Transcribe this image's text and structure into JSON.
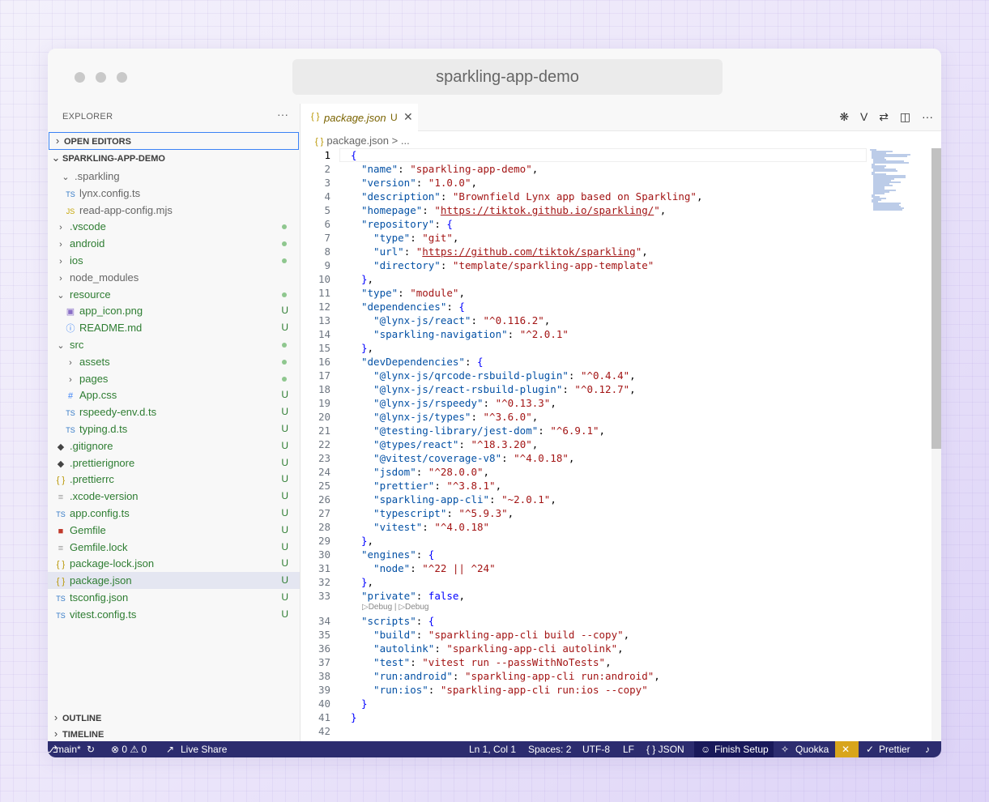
{
  "window": {
    "title": "sparkling-app-demo"
  },
  "explorer": {
    "header": "EXPLORER",
    "more": "···",
    "open_editors": "OPEN EDITORS",
    "project": "SPARKLING-APP-DEMO",
    "outline": "OUTLINE",
    "timeline": "TIMELINE",
    "items": [
      {
        "label": ".sparkling",
        "icon": "chevron-down",
        "status": ""
      },
      {
        "label": "lynx.config.ts",
        "icon": "TS",
        "status": ""
      },
      {
        "label": "read-app-config.mjs",
        "icon": "JS",
        "status": ""
      },
      {
        "label": ".vscode",
        "icon": "chevron-right",
        "status": "dot"
      },
      {
        "label": "android",
        "icon": "chevron-right",
        "status": "dot"
      },
      {
        "label": "ios",
        "icon": "chevron-right",
        "status": "dot"
      },
      {
        "label": "node_modules",
        "icon": "chevron-right",
        "status": ""
      },
      {
        "label": "resource",
        "icon": "chevron-down",
        "status": "dot"
      },
      {
        "label": "app_icon.png",
        "icon": "image",
        "status": "U"
      },
      {
        "label": "README.md",
        "icon": "info",
        "status": "U"
      },
      {
        "label": "src",
        "icon": "chevron-down",
        "status": "dot"
      },
      {
        "label": "assets",
        "icon": "chevron-right",
        "status": "dot"
      },
      {
        "label": "pages",
        "icon": "chevron-right",
        "status": "dot"
      },
      {
        "label": "App.css",
        "icon": "#",
        "status": "U"
      },
      {
        "label": "rspeedy-env.d.ts",
        "icon": "TS",
        "status": "U"
      },
      {
        "label": "typing.d.ts",
        "icon": "TS",
        "status": "U"
      },
      {
        "label": ".gitignore",
        "icon": "git",
        "status": "U"
      },
      {
        "label": ".prettierignore",
        "icon": "git",
        "status": "U"
      },
      {
        "label": ".prettierrc",
        "icon": "{}",
        "status": "U"
      },
      {
        "label": ".xcode-version",
        "icon": "lines",
        "status": "U"
      },
      {
        "label": "app.config.ts",
        "icon": "TS",
        "status": "U"
      },
      {
        "label": "Gemfile",
        "icon": "ruby",
        "status": "U"
      },
      {
        "label": "Gemfile.lock",
        "icon": "lines",
        "status": "U"
      },
      {
        "label": "package-lock.json",
        "icon": "{}",
        "status": "U"
      },
      {
        "label": "package.json",
        "icon": "{}",
        "status": "U"
      },
      {
        "label": "tsconfig.json",
        "icon": "TS",
        "status": "U"
      },
      {
        "label": "vitest.config.ts",
        "icon": "TS",
        "status": "U"
      }
    ]
  },
  "editor": {
    "tab_label": "package.json",
    "tab_modified": "U",
    "breadcrumb_file": "package.json",
    "breadcrumb_more": "> ...",
    "codelens": "▷Debug | ▷Debug",
    "actions": [
      "openai-icon",
      "V",
      "compare-icon",
      "split-icon",
      "···"
    ]
  },
  "status": {
    "branch": "main*",
    "problems": "⊗ 0 ⚠ 0",
    "live_share": "Live Share",
    "cursor": "Ln 1, Col 1",
    "spaces": "Spaces: 2",
    "encoding": "UTF-8",
    "eol": "LF",
    "language": "{ } JSON",
    "copilot": "Finish Setup",
    "quokka": "Quokka",
    "prettier": "Prettier"
  }
}
